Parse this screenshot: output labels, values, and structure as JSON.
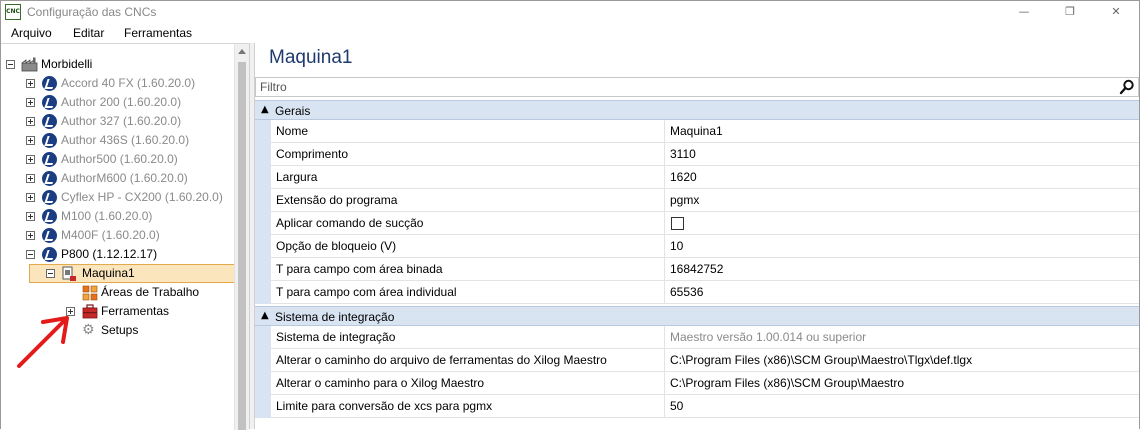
{
  "window": {
    "title": "Configuração das CNCs",
    "app_icon_text": "CNC"
  },
  "window_controls": {
    "minimize": "—",
    "maximize": "❐",
    "close": "✕"
  },
  "menu": {
    "items": [
      "Arquivo",
      "Editar",
      "Ferramentas"
    ]
  },
  "tree": {
    "root": "Morbidelli",
    "machines": [
      "Accord 40 FX (1.60.20.0)",
      "Author 200 (1.60.20.0)",
      "Author 327 (1.60.20.0)",
      "Author 436S (1.60.20.0)",
      "Author500 (1.60.20.0)",
      "AuthorM600 (1.60.20.0)",
      "Cyflex HP - CX200 (1.60.20.0)",
      "M100 (1.60.20.0)",
      "M400F (1.60.20.0)",
      "P800 (1.12.12.17)"
    ],
    "selected": "Maquina1",
    "children": [
      "Áreas de Trabalho",
      "Ferramentas",
      "Setups"
    ]
  },
  "panel": {
    "title": "Maquina1",
    "filter_placeholder": "Filtro",
    "categories": [
      {
        "label": "Gerais",
        "rows": [
          {
            "name": "Nome",
            "value": "Maquina1"
          },
          {
            "name": "Comprimento",
            "value": "3110"
          },
          {
            "name": "Largura",
            "value": "1620"
          },
          {
            "name": "Extensão do programa",
            "value": "pgmx"
          },
          {
            "name": "Aplicar comando de sucção",
            "value": "",
            "checked": false
          },
          {
            "name": "Opção de bloqueio (V)",
            "value": "10"
          },
          {
            "name": "T para campo com área binada",
            "value": "16842752"
          },
          {
            "name": "T para campo com área individual",
            "value": "65536"
          }
        ]
      },
      {
        "label": "Sistema de integração",
        "rows": [
          {
            "name": "Sistema de integração",
            "value": "Maestro versão 1.00.014 ou superior",
            "readonly": true
          },
          {
            "name": "Alterar o caminho do arquivo de ferramentas do Xilog Maestro",
            "value": "C:\\Program Files (x86)\\SCM Group\\Maestro\\Tlgx\\def.tlgx"
          },
          {
            "name": "Alterar o caminho para o Xilog Maestro",
            "value": "C:\\Program Files (x86)\\SCM Group\\Maestro"
          },
          {
            "name": "Limite para conversão de xcs para pgmx",
            "value": "50"
          }
        ]
      }
    ]
  }
}
